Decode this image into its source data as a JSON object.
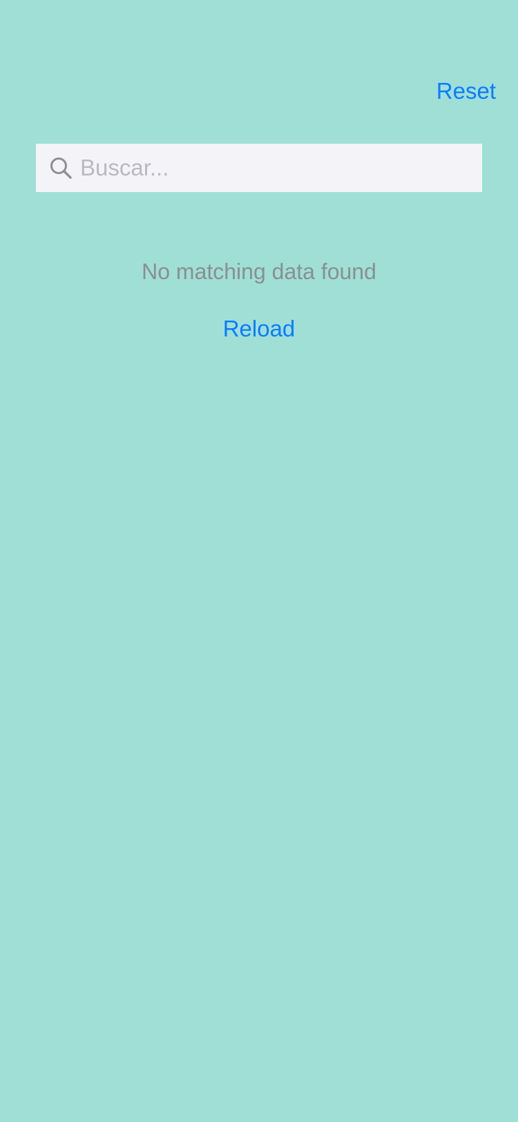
{
  "header": {
    "reset_label": "Reset"
  },
  "search": {
    "placeholder": "Buscar...",
    "value": "",
    "icon": "search-icon"
  },
  "empty_state": {
    "message": "No matching data found",
    "reload_label": "Reload"
  },
  "colors": {
    "background": "#9fdfd6",
    "accent": "#0a7cff",
    "search_background": "#f3f3f8",
    "muted_text": "#8a8f92"
  }
}
